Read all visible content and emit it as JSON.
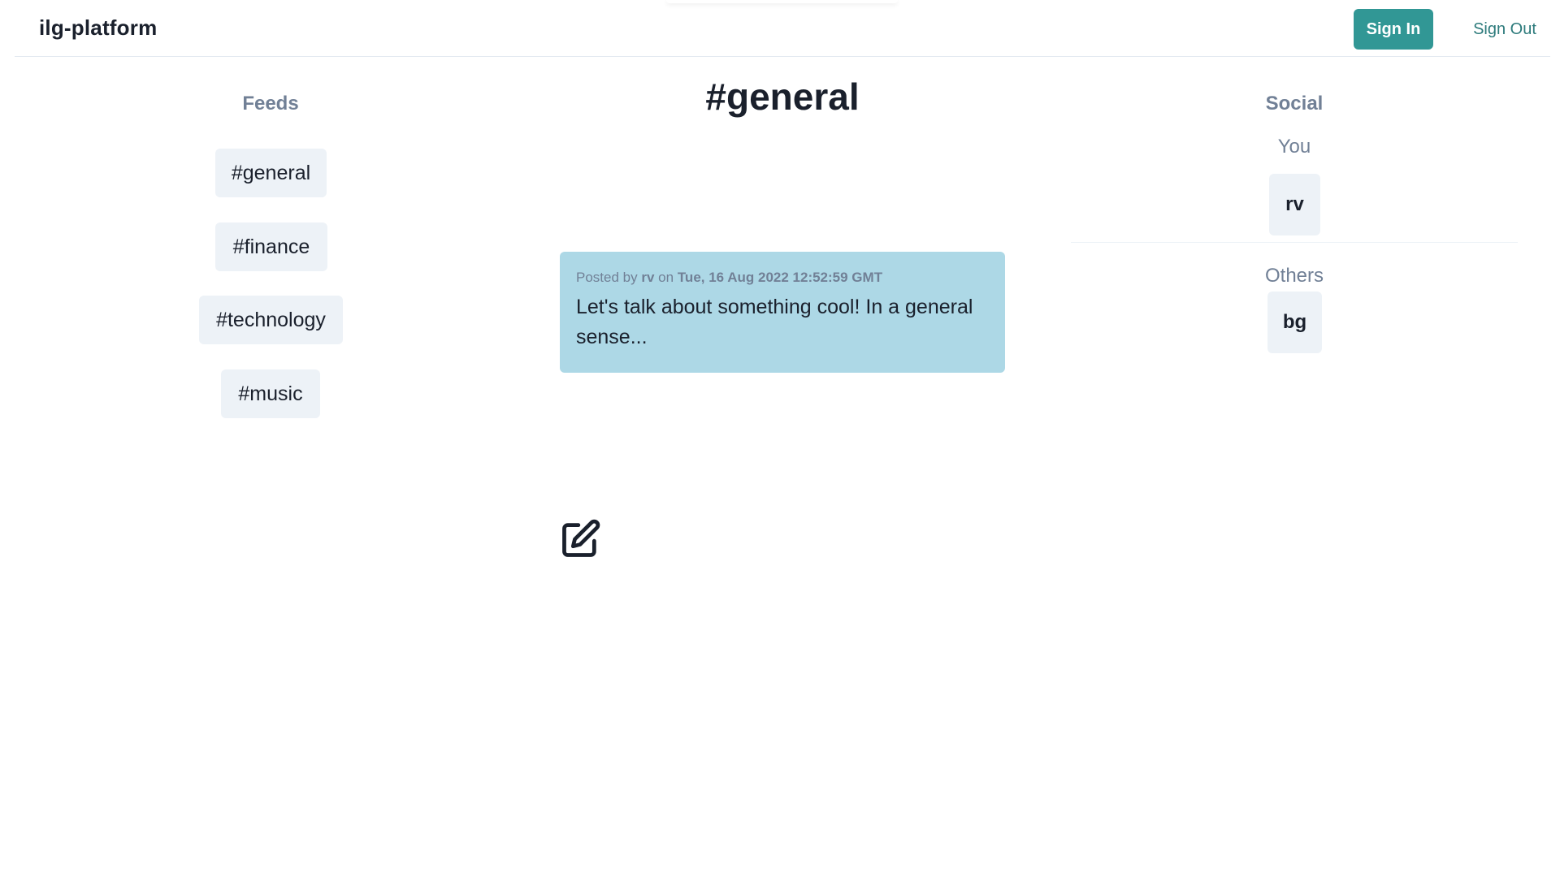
{
  "header": {
    "brand": "ilg-platform",
    "sign_in_label": "Sign In",
    "sign_out_label": "Sign Out"
  },
  "feeds": {
    "heading": "Feeds",
    "items": [
      {
        "label": "#general"
      },
      {
        "label": "#finance"
      },
      {
        "label": "#technology"
      },
      {
        "label": "#music"
      }
    ]
  },
  "channel": {
    "title": "#general",
    "posts": [
      {
        "posted_by_prefix": "Posted by",
        "author": "rv",
        "on_text": "on",
        "timestamp": "Tue, 16 Aug 2022 12:52:59 GMT",
        "body": "Let's talk about something cool! In a general sense..."
      }
    ],
    "compose_icon": "edit-icon"
  },
  "social": {
    "heading": "Social",
    "you_label": "You",
    "you_user": "rv",
    "others_label": "Others",
    "others": [
      {
        "name": "bg"
      }
    ]
  },
  "colors": {
    "accent": "#319795",
    "post_background": "#add8e6",
    "button_background": "#edf2f7",
    "muted_text": "#718096"
  }
}
